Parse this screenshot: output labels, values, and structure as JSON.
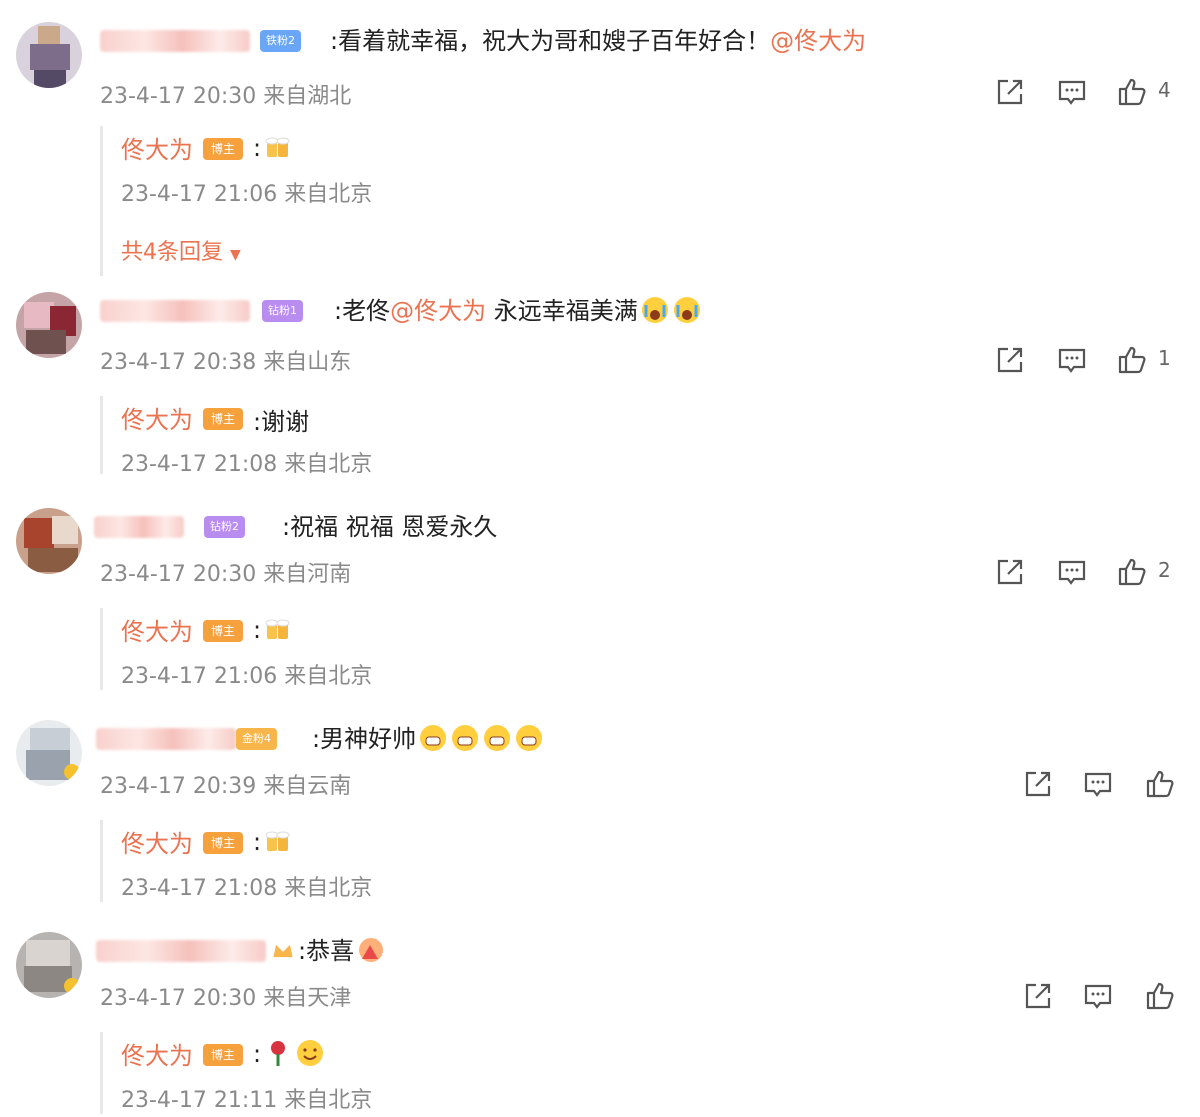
{
  "comments": [
    {
      "badge": "铁粉2",
      "text": ":看着就幸福，祝大为哥和嫂子百年好合！",
      "mention": "@佟大为",
      "meta": "23-4-17 20:30 来自湖北",
      "likes": "4",
      "reply": {
        "name": "佟大为",
        "badge": "博主",
        "text": ":",
        "meta": "23-4-17 21:06 来自北京"
      },
      "more": "共4条回复"
    },
    {
      "badge": "钻粉1",
      "text_prefix": ":老佟",
      "mention": "@佟大为",
      "text": " 永远幸福美满",
      "meta": "23-4-17 20:38 来自山东",
      "likes": "1",
      "reply": {
        "name": "佟大为",
        "badge": "博主",
        "text": ":谢谢",
        "meta": "23-4-17 21:08 来自北京"
      }
    },
    {
      "badge": "钻粉2",
      "text": ":祝福 祝福 恩爱永久",
      "meta": "23-4-17 20:30 来自河南",
      "likes": "2",
      "reply": {
        "name": "佟大为",
        "badge": "博主",
        "text": ":",
        "meta": "23-4-17 21:06 来自北京"
      }
    },
    {
      "badge": "金粉4",
      "text": ":男神好帅",
      "meta": "23-4-17 20:39 来自云南",
      "likes": "",
      "reply": {
        "name": "佟大为",
        "badge": "博主",
        "text": ":",
        "meta": "23-4-17 21:08 来自北京"
      }
    },
    {
      "badge": "",
      "text": ":恭喜",
      "meta": "23-4-17 20:30 来自天津",
      "likes": "",
      "reply": {
        "name": "佟大为",
        "badge": "博主",
        "text": ":",
        "meta": "23-4-17 21:11 来自北京"
      }
    }
  ],
  "icons": {
    "share": "share-icon",
    "comment": "comment-icon",
    "like": "like-icon",
    "more_arrow": "caret-down-icon"
  },
  "colors": {
    "accent": "#eb7350",
    "boss_badge": "#f7a13c",
    "iron_badge": "#6aa6f8",
    "diamond_badge": "#b98cf0",
    "gold_badge": "#f8b54a"
  }
}
